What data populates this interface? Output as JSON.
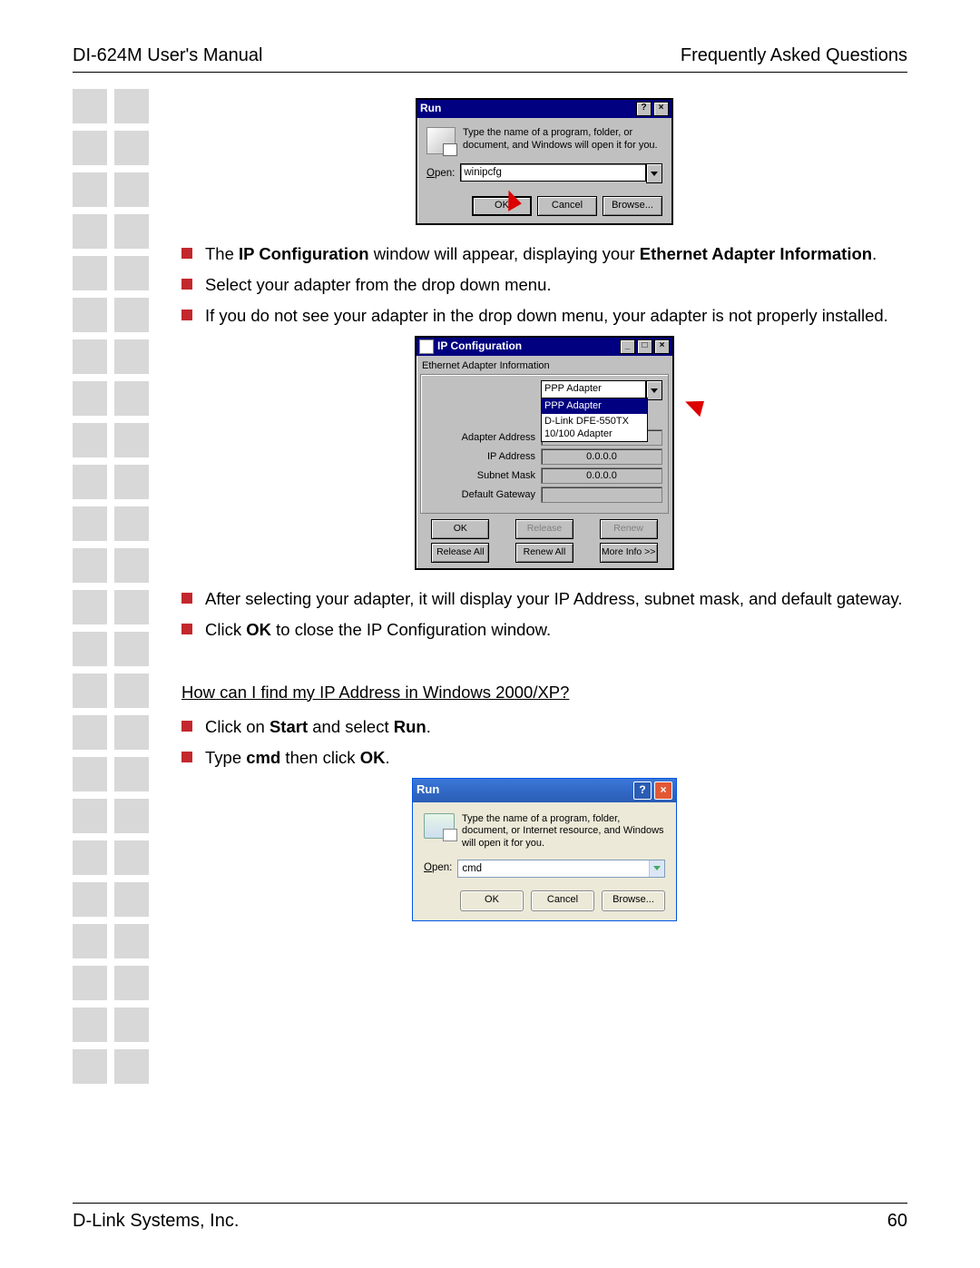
{
  "header": {
    "left": "DI-624M User's Manual",
    "right": "Frequently Asked Questions"
  },
  "footer": {
    "left": "D-Link Systems, Inc.",
    "right": "60"
  },
  "run98": {
    "title": "Run",
    "desc": "Type the name of a program, folder, or document, and Windows will open it for you.",
    "open_label_u": "O",
    "open_label_rest": "pen:",
    "open_value": "winipcfg",
    "ok": "OK",
    "cancel": "Cancel",
    "browse_u": "B",
    "browse_rest": "rowse..."
  },
  "bullets1": {
    "i0a": "The ",
    "i0b": "IP Configuration",
    "i0c": " window will appear, displaying your ",
    "i0d": "Ethernet Adapter Information",
    "i0e": ".",
    "i1": "Select your adapter from the drop down menu.",
    "i2": "If you do not see your adapter in the drop down menu, your adapter is not properly installed."
  },
  "ipcfg": {
    "title": "IP Configuration",
    "group": "Ethernet  Adapter Information",
    "selected": "PPP Adapter",
    "opt0": "PPP Adapter",
    "opt1": "D-Link DFE-550TX 10/100 Adapter",
    "row0_lbl": "Adapter Address",
    "row0_val": "",
    "row1_lbl": "IP Address",
    "row1_val": "0.0.0.0",
    "row2_lbl": "Subnet Mask",
    "row2_val": "0.0.0.0",
    "row3_lbl": "Default Gateway",
    "row3_val": "",
    "b_ok": "OK",
    "b_release": "Release",
    "b_renew": "Renew",
    "b_releaseall": "Release All",
    "b_renewall": "Renew All",
    "b_more_u": "M",
    "b_more_rest": "ore Info >>"
  },
  "bullets2": {
    "i0": "After selecting your adapter, it will display your IP Address, subnet mask, and default gateway.",
    "i1a": "Click ",
    "i1b": "OK",
    "i1c": " to close the IP Configuration window."
  },
  "q2": "How can I find my IP Address in Windows 2000/XP?",
  "bullets3": {
    "i0a": "Click on ",
    "i0b": "Start",
    "i0c": " and select ",
    "i0d": "Run",
    "i0e": ".",
    "i1a": "Type ",
    "i1b": "cmd",
    "i1c": " then click ",
    "i1d": "OK",
    "i1e": "."
  },
  "runxp": {
    "title": "Run",
    "desc": "Type the name of a program, folder, document, or Internet resource, and Windows will open it for you.",
    "open_label_u": "O",
    "open_label_rest": "pen:",
    "open_value": "cmd",
    "ok": "OK",
    "cancel": "Cancel",
    "browse_u": "B",
    "browse_rest": "rowse..."
  }
}
